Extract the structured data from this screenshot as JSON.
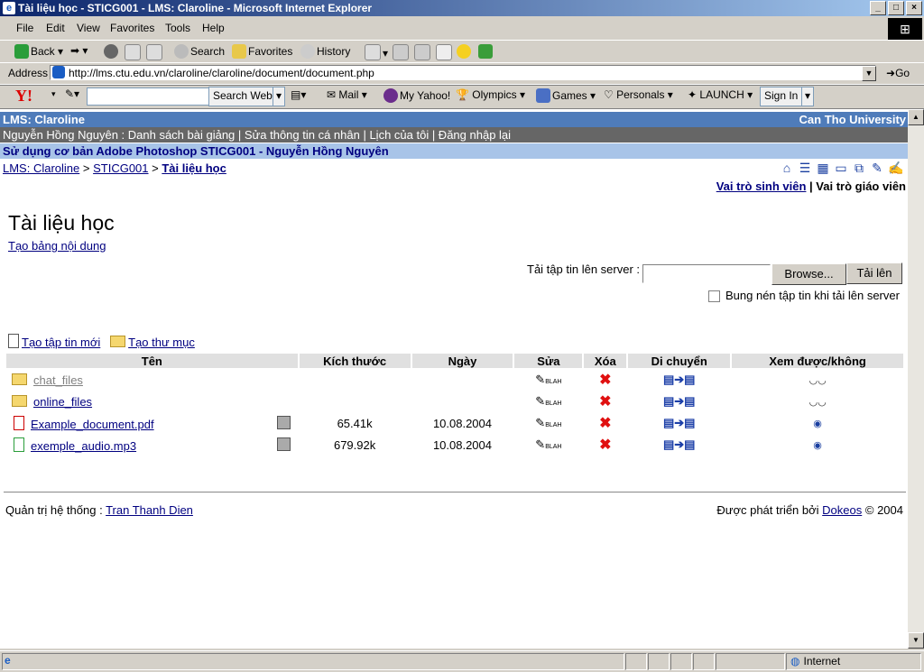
{
  "window": {
    "title": "Tài liệu học - STICG001 - LMS: Claroline - Microsoft Internet Explorer"
  },
  "menu": [
    "File",
    "Edit",
    "View",
    "Favorites",
    "Tools",
    "Help"
  ],
  "toolbar": {
    "back": "Back",
    "search": "Search",
    "favorites": "Favorites",
    "history": "History"
  },
  "address": {
    "label": "Address",
    "url": "http://lms.ctu.edu.vn/claroline/claroline/document/document.php",
    "go": "Go"
  },
  "yahoo": {
    "search_web": "Search Web",
    "mail": "Mail",
    "my_yahoo": "My Yahoo!",
    "olympics": "Olympics",
    "games": "Games",
    "personals": "Personals",
    "launch": "LAUNCH",
    "sign_in": "Sign In"
  },
  "page": {
    "site_name": "LMS: Claroline",
    "university": "Can Tho University",
    "user_bar": "Nguyễn Hồng Nguyên : Danh sách bài giảng | Sửa thông tin cá nhân | Lịch của tôi | Đăng nhập lại",
    "course_title": "Sử dụng cơ bản Adobe Photoshop STICG001 - Nguyễn Hồng Nguyên",
    "breadcrumb": {
      "home": "LMS: Claroline",
      "course": "STICG001",
      "current": "Tài liệu học"
    },
    "roles": {
      "student": "Vai trò sinh viên",
      "separator": " | ",
      "teacher": "Vai trò giáo viên"
    },
    "heading": "Tài liệu học",
    "toc_link": "Tạo bảng nội dung",
    "upload": {
      "label": "Tải tập tin lên server :",
      "browse": "Browse...",
      "submit": "Tải lên",
      "unzip_label": "Bung nén tập tin khi tải lên server"
    },
    "new_file": "Tạo tập tin mới",
    "new_folder": "Tạo thư mục",
    "columns": [
      "Tên",
      "Kích thước",
      "Ngày",
      "Sửa",
      "Xóa",
      "Di chuyển",
      "Xem được/không"
    ],
    "rows": [
      {
        "name": "chat_files",
        "type": "folder",
        "size": "",
        "date": "",
        "visible": false
      },
      {
        "name": "online_files",
        "type": "folder",
        "size": "",
        "date": "",
        "visible": false
      },
      {
        "name": "Example_document.pdf",
        "type": "pdf",
        "size": "65.41k",
        "date": "10.08.2004",
        "visible": true
      },
      {
        "name": "exemple_audio.mp3",
        "type": "audio",
        "size": "679.92k",
        "date": "10.08.2004",
        "visible": true
      }
    ],
    "footer": {
      "admin_label": "Quản trị hệ thống :",
      "admin_name": "Tran Thanh Dien",
      "powered": "Được phát triển bởi",
      "powered_link": "Dokeos",
      "copyright": "© 2004"
    }
  },
  "status": {
    "zone": "Internet"
  }
}
